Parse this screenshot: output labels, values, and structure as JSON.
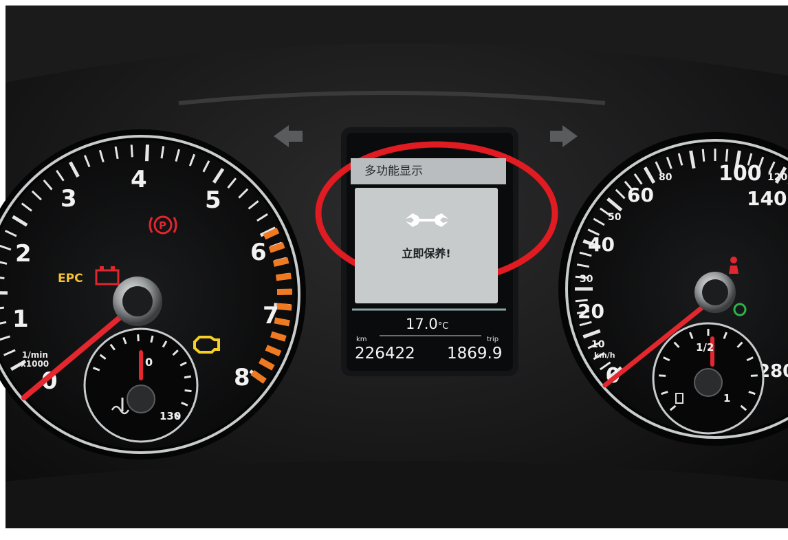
{
  "mfd": {
    "title": "多功能显示",
    "message": "立即保养!",
    "temperature": "17.0",
    "temperature_unit": "°C",
    "odometer_label": "km",
    "odometer": "226422",
    "trip_label": "trip",
    "trip": "1869.9"
  },
  "tachometer": {
    "numbers": [
      "1",
      "2",
      "3",
      "4",
      "5",
      "6",
      "7",
      "8"
    ],
    "unit_line1": "1/min",
    "unit_line2": "x1000",
    "zero": "0"
  },
  "coolant_gauge": {
    "low": "0",
    "high": "130"
  },
  "speedometer": {
    "numbers": [
      "0",
      "10",
      "20",
      "30",
      "40",
      "50",
      "60",
      "80",
      "100",
      "120",
      "140",
      "280"
    ],
    "unit": "km/h"
  },
  "fuel_gauge": {
    "half": "1/2",
    "full": "1"
  },
  "warning_lights": {
    "epc": "EPC",
    "parking_brake": "P"
  },
  "colors": {
    "needle": "#e4262e",
    "redzone": "#f07a22",
    "highlight_ellipse": "#e01b22",
    "epc": "#f6c233",
    "check_engine": "#f5cf26",
    "mfd_screen": "#c7cbcc"
  },
  "icons": [
    "left-turn-arrow-icon",
    "right-turn-arrow-icon",
    "wrench-icon",
    "parking-brake-icon",
    "battery-icon",
    "check-engine-icon",
    "fuel-pump-icon",
    "thermometer-icon",
    "seatbelt-icon",
    "high-beam-icon"
  ]
}
